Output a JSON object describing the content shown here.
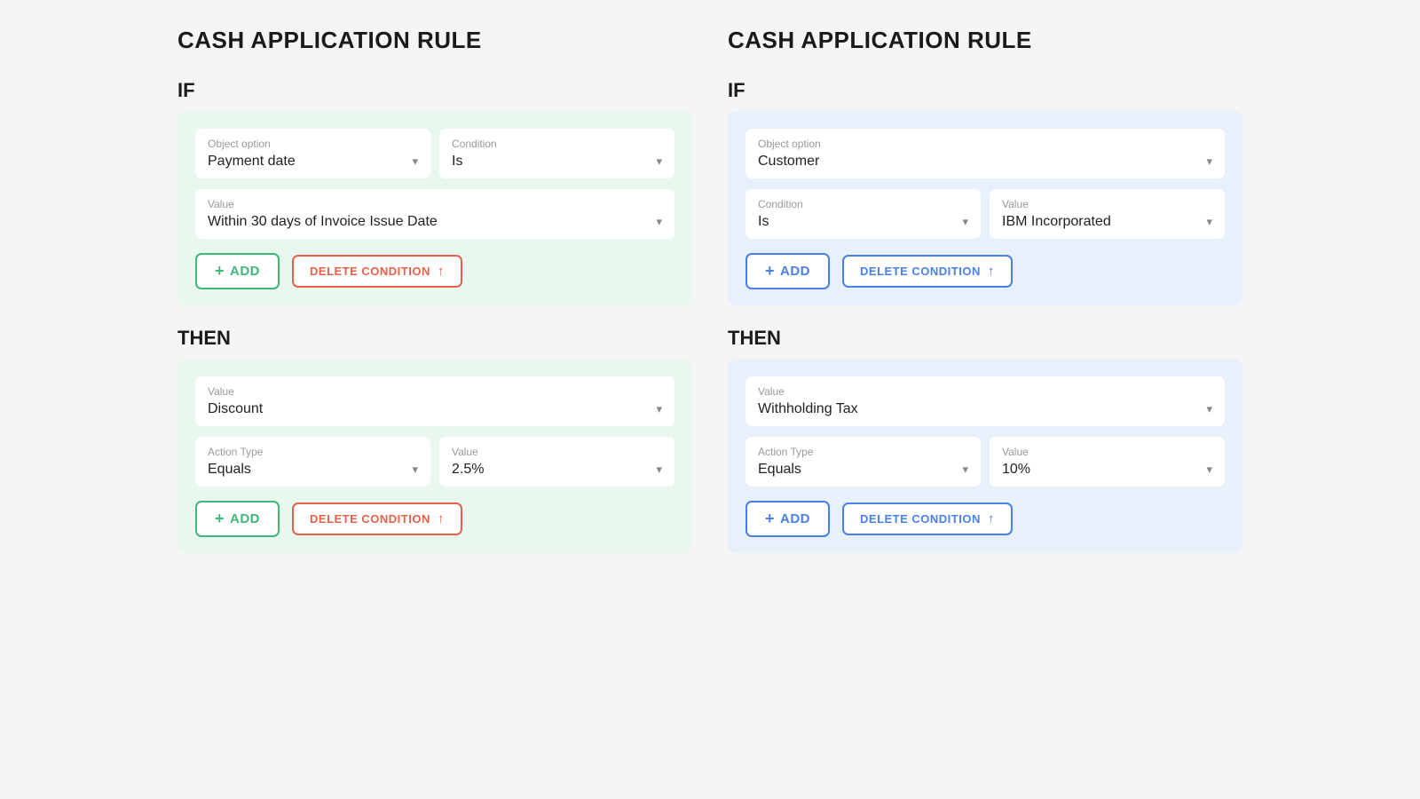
{
  "left": {
    "title": "CASH APPLICATION RULE",
    "if_label": "IF",
    "then_label": "THEN",
    "if_card": {
      "row1": [
        {
          "label": "Object option",
          "value": "Payment date"
        },
        {
          "label": "Condition",
          "value": "Is"
        }
      ],
      "row2": [
        {
          "label": "Value",
          "value": "Within 30 days of Invoice Issue Date"
        }
      ],
      "add_label": "+ ADD",
      "delete_label": "DELETE CONDITION"
    },
    "then_card": {
      "row1": [
        {
          "label": "Value",
          "value": "Discount"
        }
      ],
      "row2": [
        {
          "label": "Action Type",
          "value": "Equals"
        },
        {
          "label": "Value",
          "value": "2.5%"
        }
      ],
      "add_label": "+ ADD",
      "delete_label": "DELETE CONDITION"
    }
  },
  "right": {
    "title": "CASH APPLICATION RULE",
    "if_label": "IF",
    "then_label": "THEN",
    "if_card": {
      "row1": [
        {
          "label": "Object option",
          "value": "Customer"
        }
      ],
      "row2": [
        {
          "label": "Condition",
          "value": "Is"
        },
        {
          "label": "Value",
          "value": "IBM Incorporated"
        }
      ],
      "add_label": "+ ADD",
      "delete_label": "DELETE CONDITION"
    },
    "then_card": {
      "row1": [
        {
          "label": "Value",
          "value": "Withholding Tax"
        }
      ],
      "row2": [
        {
          "label": "Action Type",
          "value": "Equals"
        },
        {
          "label": "Value",
          "value": "10%"
        }
      ],
      "add_label": "+ ADD",
      "delete_label": "DELETE CONDITION"
    }
  },
  "icons": {
    "chevron": "▾",
    "plus": "+",
    "arrow_up": "↑"
  }
}
